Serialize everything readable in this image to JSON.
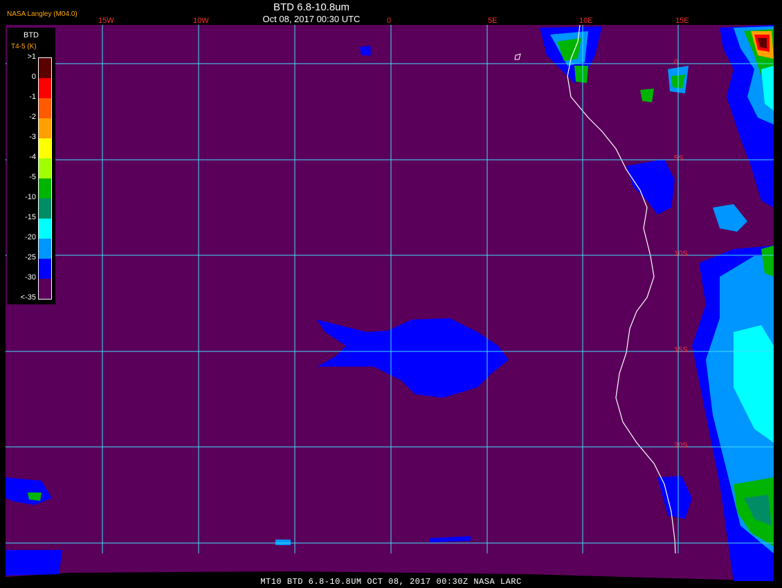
{
  "header": {
    "title": "BTD 6.8-10.8um",
    "datetime": "Oct 08, 2017 00:30 UTC",
    "credit": "NASA Langley (M04.0)"
  },
  "footer": {
    "text": "MT10  BTD 6.8-10.8UM   OCT 08, 2017 00:30Z   NASA LARC"
  },
  "grid": {
    "longitudes": [
      "15W",
      "10W",
      "0",
      "5E",
      "10E",
      "15E"
    ],
    "latitudes": [
      "0",
      "5S",
      "10S",
      "15S",
      "20S"
    ]
  },
  "legend": {
    "title": "BTD",
    "subtitle": "T4-5 (K)",
    "ticks": [
      ">1",
      "0",
      "-1",
      "-2",
      "-3",
      "-4",
      "-5",
      "-10",
      "-15",
      "-20",
      "-25",
      "-30",
      "<-35"
    ],
    "colors": [
      "#5a0000",
      "#ff0000",
      "#ff5a00",
      "#ffa000",
      "#ffff00",
      "#a0ff00",
      "#00b400",
      "#008c64",
      "#00ffff",
      "#0096ff",
      "#0000ff",
      "#5a005a"
    ]
  },
  "colors": {
    "background_sea": "#5a005a",
    "gridline": "#40e0ff",
    "coastline": "#ffffff",
    "grid_label": "#ff3030"
  }
}
